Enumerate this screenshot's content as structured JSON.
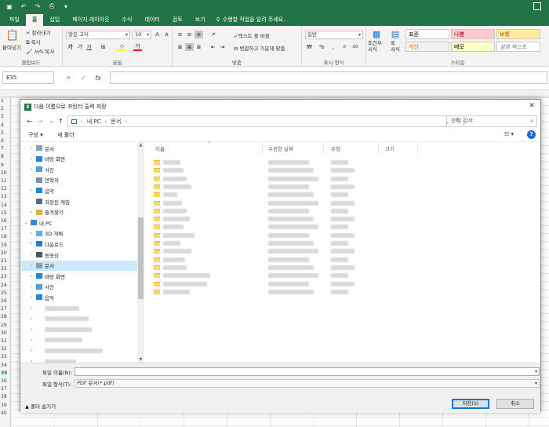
{
  "app": {
    "quick_access": [
      "save-icon",
      "undo-icon",
      "redo-icon",
      "customize-icon"
    ]
  },
  "tabs": [
    "파일",
    "홈",
    "삽입",
    "페이지 레이아웃",
    "수식",
    "데이터",
    "검토",
    "보기"
  ],
  "active_tab": "홈",
  "tell_me": "수행할 작업을 알려 주세요.",
  "ribbon": {
    "clipboard": {
      "label": "클립보드",
      "paste": "붙여넣기",
      "cut": "잘라내기",
      "copy": "복사",
      "format_painter": "서식 복사"
    },
    "font": {
      "label": "글꼴",
      "name": "맑은 고딕",
      "size": "10"
    },
    "alignment": {
      "label": "맞춤",
      "wrap": "텍스트 줄 바꿈",
      "merge": "병합하고 가운데 맞춤"
    },
    "number": {
      "label": "표시 형식",
      "format": "일반"
    },
    "styles": {
      "label": "스타일",
      "conditional": "조건부\n서식",
      "table": "표\n서식",
      "cells": [
        {
          "label": "표준",
          "bg": "#ffffff",
          "fg": "#000000"
        },
        {
          "label": "나쁨",
          "bg": "#ffc7ce",
          "fg": "#9c0006"
        },
        {
          "label": "보통",
          "bg": "#ffeb9c",
          "fg": "#9c5700"
        },
        {
          "label": "계산",
          "bg": "#f2f2f2",
          "fg": "#fa7d00"
        },
        {
          "label": "메모",
          "bg": "#ffffcc",
          "fg": "#000000"
        },
        {
          "label": "설명 텍스트",
          "bg": "#ffffff",
          "fg": "#7f7f7f"
        }
      ]
    }
  },
  "formula_bar": {
    "cell_ref": "E35",
    "value": ""
  },
  "sheet": {
    "row_numbers": [
      "1",
      "2",
      "3",
      "4",
      "5",
      "6",
      "7",
      "8",
      "9",
      "10",
      "11",
      "12",
      "13",
      "14",
      "15",
      "16",
      "17",
      "18",
      "19",
      "20",
      "21",
      "22",
      "23",
      "24",
      "25",
      "26",
      "27",
      "28",
      "29",
      "30",
      "31",
      "32",
      "33",
      "34",
      "35",
      "36",
      "37",
      "38",
      "39",
      "40"
    ]
  },
  "dialog": {
    "title": "다음 이름으로 프린터 출력 저장",
    "breadcrumb": [
      "내 PC",
      "문서"
    ],
    "search_placeholder": "문서 검색",
    "toolbar": {
      "organize": "구성",
      "new_folder": "새 폴더"
    },
    "nav_items": [
      {
        "label": "문서",
        "icon": "documents-icon",
        "indent": 1,
        "chevron": "›"
      },
      {
        "label": "바탕 화면",
        "icon": "desktop-icon",
        "indent": 1,
        "chevron": "›"
      },
      {
        "label": "사진",
        "icon": "pictures-icon",
        "indent": 1,
        "chevron": "›"
      },
      {
        "label": "연락처",
        "icon": "contacts-icon",
        "indent": 1,
        "chevron": ""
      },
      {
        "label": "음악",
        "icon": "music-icon",
        "indent": 1,
        "chevron": "›"
      },
      {
        "label": "저장된 게임",
        "icon": "saved-games-icon",
        "indent": 1,
        "chevron": ""
      },
      {
        "label": "즐겨찾기",
        "icon": "favorites-icon",
        "indent": 1,
        "chevron": "›"
      },
      {
        "label": "내 PC",
        "icon": "pc-icon",
        "indent": 0,
        "chevron": "⌄"
      },
      {
        "label": "3D 개체",
        "icon": "3d-objects-icon",
        "indent": 1,
        "chevron": "›"
      },
      {
        "label": "다운로드",
        "icon": "downloads-icon",
        "indent": 1,
        "chevron": "›"
      },
      {
        "label": "동영상",
        "icon": "videos-icon",
        "indent": 1,
        "chevron": "›"
      },
      {
        "label": "문서",
        "icon": "documents-icon",
        "indent": 1,
        "chevron": "›"
      },
      {
        "label": "바탕 화면",
        "icon": "desktop-icon",
        "indent": 1,
        "chevron": "›"
      },
      {
        "label": "사진",
        "icon": "pictures-icon",
        "indent": 1,
        "chevron": "›"
      },
      {
        "label": "음악",
        "icon": "music-icon",
        "indent": 1,
        "chevron": "›"
      }
    ],
    "columns": [
      "이름",
      "수정한 날짜",
      "유형",
      "크기"
    ],
    "file_name_label": "파일 이름(N):",
    "file_name_value": "",
    "file_type_label": "파일 형식(T):",
    "file_type_value": "PDF 문서(*.pdf)",
    "hide_folders": "폴더 숨기기",
    "save_button": "저장(S)",
    "cancel_button": "취소"
  }
}
